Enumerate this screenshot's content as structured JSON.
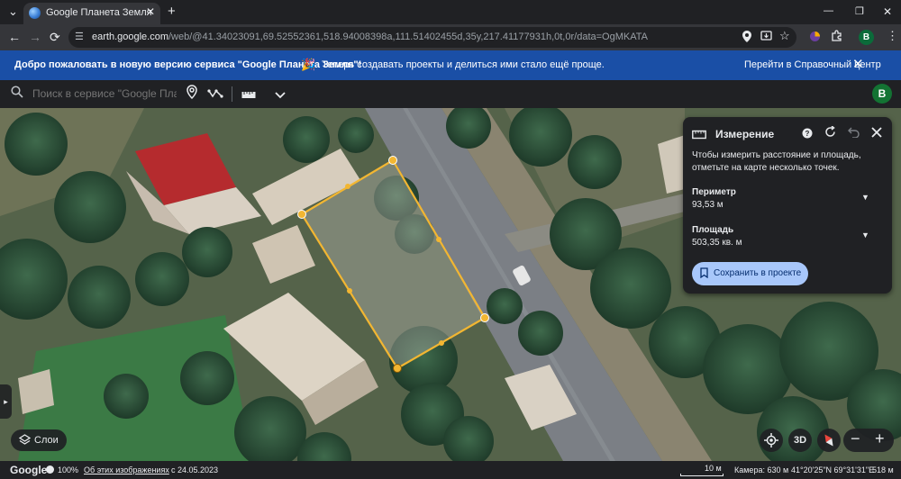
{
  "browser": {
    "tab_title": "Google Планета Земля",
    "tab_close": "✕",
    "new_tab": "+",
    "window_minimize": "—",
    "window_restore": "❐",
    "window_close": "✕",
    "url_host": "earth.google.com",
    "url_path": "/web/@41.34023091,69.52552361,518.94008398a,111.51402455d,35y,217.41177931h,0t,0r/data=OgMKATA",
    "profile_letter": "B"
  },
  "banner": {
    "welcome": "Добро пожаловать в новую версию сервиса \"Google Планета Земля\"!",
    "emoji": "🎉",
    "message": "Теперь создавать проекты и делиться ими стало ещё проще.",
    "help_link": "Перейти в Справочный центр",
    "close": "✕"
  },
  "toolbar": {
    "search_placeholder": "Поиск в сервисе \"Google Планета Земля\"",
    "profile_letter": "B"
  },
  "panel": {
    "title": "Измерение",
    "hint": "Чтобы измерить расстояние и площадь, отметьте на карте несколько точек.",
    "perimeter_label": "Периметр",
    "perimeter_value": "93,53 м",
    "area_label": "Площадь",
    "area_value": "503,35 кв. м",
    "save_label": "Сохранить в проекте"
  },
  "map": {
    "layers_label": "Слои",
    "btn_3d": "3D",
    "zoom_out": "−",
    "zoom_in": "+",
    "side_arrow": "▸"
  },
  "status": {
    "logo": "Google",
    "percent": "100%",
    "about_images": "Об этих изображениях",
    "date": "с 24.05.2023",
    "scale": "10 м",
    "camera": "Камера: 630 м",
    "coords": "41°20'25\"N 69°31'31\"E",
    "elevation": "518 м"
  },
  "colors": {
    "banner_blue": "#1a4fa6",
    "measure_yellow": "#f2b632",
    "save_button": "#a8c7fa",
    "roof_red": "#c0262c"
  }
}
